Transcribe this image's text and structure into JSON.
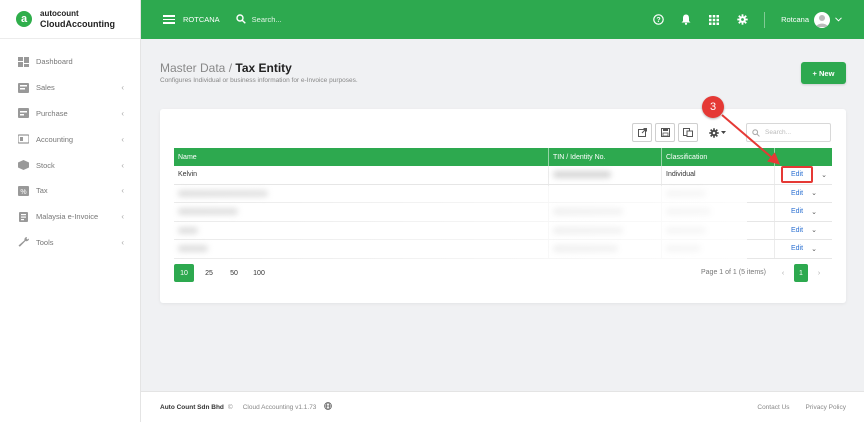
{
  "app": {
    "logo_top": "autocount",
    "logo_bottom": "CloudAccounting",
    "logo_letter": "a"
  },
  "sidebar": {
    "items": [
      {
        "label": "Dashboard",
        "icon": "dashboard-icon",
        "has_chevron": false
      },
      {
        "label": "Sales",
        "icon": "sales-icon",
        "has_chevron": true
      },
      {
        "label": "Purchase",
        "icon": "purchase-icon",
        "has_chevron": true
      },
      {
        "label": "Accounting",
        "icon": "accounting-icon",
        "has_chevron": true
      },
      {
        "label": "Stock",
        "icon": "stock-icon",
        "has_chevron": true
      },
      {
        "label": "Tax",
        "icon": "tax-icon",
        "has_chevron": true
      },
      {
        "label": "Malaysia e-Invoice",
        "icon": "einvoice-icon",
        "has_chevron": true
      },
      {
        "label": "Tools",
        "icon": "wrench-icon",
        "has_chevron": true
      }
    ]
  },
  "header": {
    "company": "ROTCANA",
    "search_placeholder": "Search...",
    "user_name": "Rotcana"
  },
  "page": {
    "breadcrumb_parent": "Master Data",
    "breadcrumb_sep": " / ",
    "title": "Tax Entity",
    "subtitle": "Configures Individual or business information for e-Invoice purposes.",
    "new_button": "+ New"
  },
  "table": {
    "search_placeholder": "Search...",
    "columns": [
      "Name",
      "TIN / Identity No.",
      "Classification",
      ""
    ],
    "rows": [
      {
        "name": "Kelvin",
        "tin": "",
        "classification": "Individual",
        "action": "Edit",
        "highlighted": true
      },
      {
        "name": "",
        "tin": "",
        "classification": "",
        "action": "Edit",
        "highlighted": false
      },
      {
        "name": "",
        "tin": "",
        "classification": "",
        "action": "Edit",
        "highlighted": false
      },
      {
        "name": "",
        "tin": "",
        "classification": "",
        "action": "Edit",
        "highlighted": false
      },
      {
        "name": "",
        "tin": "",
        "classification": "",
        "action": "Edit",
        "highlighted": false
      }
    ]
  },
  "pagination": {
    "page_sizes": [
      "10",
      "25",
      "50",
      "100"
    ],
    "active_size": "10",
    "info": "Page 1 of 1 (5 items)",
    "current_page": "1"
  },
  "annotation": {
    "step": "3"
  },
  "footer": {
    "company": "Auto Count Sdn Bhd",
    "copyright": "©",
    "version": "Cloud Accounting v1.1.73",
    "contact": "Contact Us",
    "privacy": "Privacy Policy"
  },
  "colors": {
    "brand_green": "#2da94f",
    "link_blue": "#2a6fd1",
    "annotation_red": "#e53935"
  }
}
